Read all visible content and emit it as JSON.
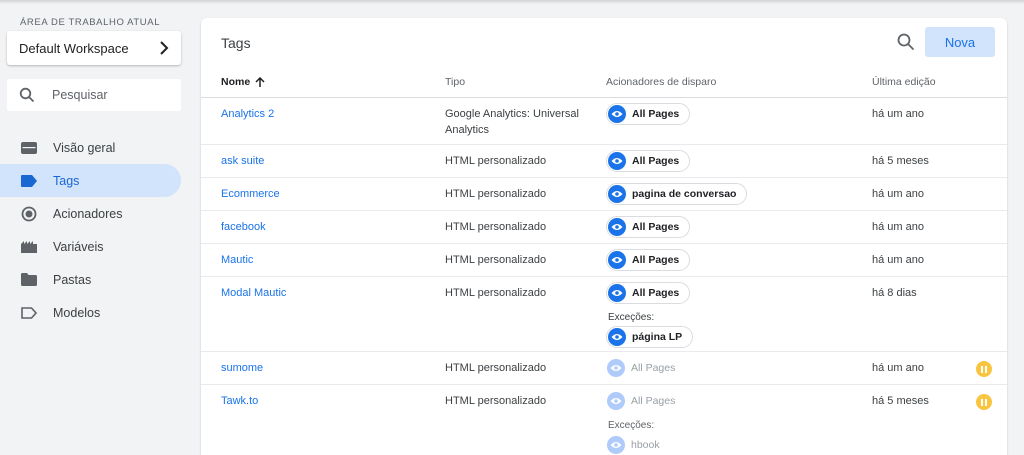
{
  "sidebar": {
    "workspace_label": "ÁREA DE TRABALHO ATUAL",
    "workspace_name": "Default Workspace",
    "search_placeholder": "Pesquisar",
    "items": [
      {
        "label": "Visão geral",
        "icon": "overview-icon"
      },
      {
        "label": "Tags",
        "icon": "tag-icon",
        "active": true
      },
      {
        "label": "Acionadores",
        "icon": "trigger-icon"
      },
      {
        "label": "Variáveis",
        "icon": "variables-icon"
      },
      {
        "label": "Pastas",
        "icon": "folder-icon"
      },
      {
        "label": "Modelos",
        "icon": "template-icon"
      }
    ]
  },
  "main": {
    "title": "Tags",
    "new_button": "Nova",
    "columns": {
      "name": "Nome",
      "type": "Tipo",
      "triggers": "Acionadores de disparo",
      "last_edit": "Última edição"
    },
    "exceptions_label": "Exceções:",
    "rows": [
      {
        "name": "Analytics 2",
        "type": "Google Analytics: Universal Analytics",
        "trigger": "All Pages",
        "last_edit": "há um ano"
      },
      {
        "name": "ask suite",
        "type": "HTML personalizado",
        "trigger": "All Pages",
        "last_edit": "há 5 meses"
      },
      {
        "name": "Ecommerce",
        "type": "HTML personalizado",
        "trigger": "pagina de conversao",
        "last_edit": "há um ano"
      },
      {
        "name": "facebook",
        "type": "HTML personalizado",
        "trigger": "All Pages",
        "last_edit": "há um ano"
      },
      {
        "name": "Mautic",
        "type": "HTML personalizado",
        "trigger": "All Pages",
        "last_edit": "há um ano"
      },
      {
        "name": "Modal Mautic",
        "type": "HTML personalizado",
        "trigger": "All Pages",
        "exception": "página LP",
        "last_edit": "há 8 dias"
      },
      {
        "name": "sumome",
        "type": "HTML personalizado",
        "trigger": "All Pages",
        "last_edit": "há um ano",
        "paused": true
      },
      {
        "name": "Tawk.to",
        "type": "HTML personalizado",
        "trigger": "All Pages",
        "exception": "hbook",
        "last_edit": "há 5 meses",
        "paused": true
      }
    ]
  },
  "colors": {
    "accent": "#1a73e8",
    "accent_light": "#d2e3fc",
    "paused": "#f9c440"
  }
}
